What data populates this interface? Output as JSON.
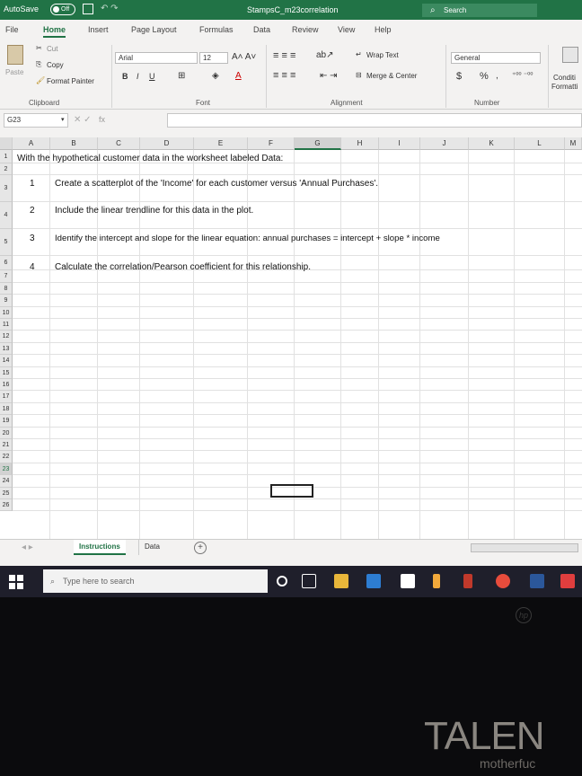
{
  "titlebar": {
    "autosave_label": "AutoSave",
    "autosave_state": "Off",
    "title": "StampsC_m23correlation",
    "search_label": "Search"
  },
  "menu_tabs": [
    "File",
    "Home",
    "Insert",
    "Page Layout",
    "Formulas",
    "Data",
    "Review",
    "View",
    "Help"
  ],
  "ribbon": {
    "paste": "Paste",
    "cut": "Cut",
    "copy": "Copy",
    "format_painter": "Format Painter",
    "clipboard": "Clipboard",
    "font_name": "Arial",
    "font_size": "12",
    "font_group": "Font",
    "bold": "B",
    "italic": "I",
    "underline": "U",
    "wrap_text": "Wrap Text",
    "merge_center": "Merge & Center",
    "alignment": "Alignment",
    "number_format": "General",
    "number_group": "Number",
    "conditional_1": "Conditi",
    "conditional_2": "Formatti",
    "currency": "$",
    "percent": "%"
  },
  "formula_bar": {
    "name_box": "G23",
    "fx": "fx"
  },
  "columns": [
    "A",
    "B",
    "C",
    "D",
    "E",
    "F",
    "G",
    "H",
    "I",
    "J",
    "K",
    "L",
    "M"
  ],
  "rows": [
    "1",
    "2",
    "3",
    "4",
    "5",
    "6",
    "7",
    "8",
    "9",
    "10",
    "11",
    "12",
    "13",
    "14",
    "15",
    "16",
    "17",
    "18",
    "19",
    "20",
    "21",
    "22",
    "23",
    "24",
    "25",
    "26"
  ],
  "cells": {
    "row1": "With the hypothetical customer data in the worksheet labeled Data:",
    "items": [
      {
        "num": "1",
        "text": "Create a scatterplot of the 'Income' for each customer versus 'Annual Purchases'."
      },
      {
        "num": "2",
        "text": "Include the linear trendline for this data in the plot."
      },
      {
        "num": "3",
        "text": "Identify the intercept and slope for the linear equation: annual purchases = intercept + slope * income"
      },
      {
        "num": "4",
        "text": "Calculate the correlation/Pearson coefficient for this relationship."
      }
    ]
  },
  "sheet_tabs": [
    "Instructions",
    "Data"
  ],
  "add_sheet": "+",
  "taskbar": {
    "search_placeholder": "Type here to search"
  },
  "monitor": {
    "logo": "hp",
    "bg_text_1": "TALEN",
    "bg_text_2": "motherfuc"
  },
  "colors": {
    "excel_green": "#217346",
    "taskbar": "#1f1f2b"
  }
}
